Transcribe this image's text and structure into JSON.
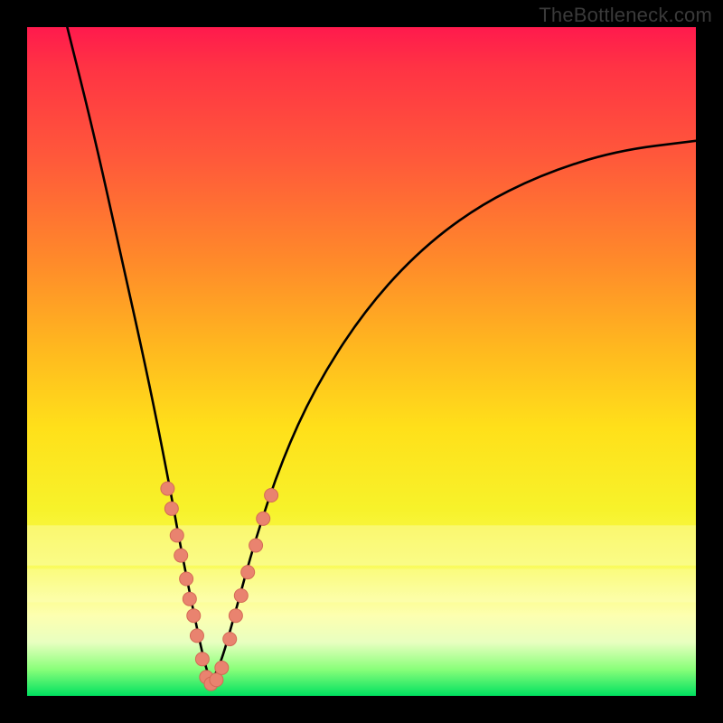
{
  "watermark": "TheBottleneck.com",
  "colors": {
    "curve": "#000000",
    "dot_fill": "#e9836f",
    "dot_stroke": "#d46a55",
    "hband_soft": "rgba(255,255,255,0.28)",
    "hband_softer": "rgba(255,255,255,0.18)"
  },
  "chart_data": {
    "type": "line",
    "title": "",
    "xlabel": "",
    "ylabel": "",
    "xlim": [
      0,
      100
    ],
    "ylim": [
      0,
      100
    ],
    "note": "Axes unlabeled; values estimated from pixel positions on a 0–100 normalized domain. y=0 means bottom (green), y=100 means top (red). Curve is a V-shaped bottleneck curve with minimum near x≈27.",
    "series": [
      {
        "name": "bottleneck-curve",
        "x": [
          6,
          10,
          14,
          18,
          21,
          23,
          25,
          26.5,
          27.5,
          29,
          31,
          34,
          38,
          43,
          50,
          58,
          67,
          77,
          88,
          100
        ],
        "y": [
          100,
          84,
          66,
          48,
          33,
          22,
          12,
          5,
          2,
          5,
          12,
          23,
          35,
          46,
          57,
          66,
          73,
          78,
          81.5,
          83
        ]
      }
    ],
    "marker_groups": [
      {
        "name": "left-branch-markers",
        "points": [
          {
            "x": 21.0,
            "y": 31.0
          },
          {
            "x": 21.6,
            "y": 28.0
          },
          {
            "x": 22.4,
            "y": 24.0
          },
          {
            "x": 23.0,
            "y": 21.0
          },
          {
            "x": 23.8,
            "y": 17.5
          },
          {
            "x": 24.3,
            "y": 14.5
          },
          {
            "x": 24.9,
            "y": 12.0
          },
          {
            "x": 25.4,
            "y": 9.0
          },
          {
            "x": 26.2,
            "y": 5.5
          }
        ]
      },
      {
        "name": "valley-markers",
        "points": [
          {
            "x": 26.8,
            "y": 2.8
          },
          {
            "x": 27.5,
            "y": 1.8
          },
          {
            "x": 28.3,
            "y": 2.4
          },
          {
            "x": 29.1,
            "y": 4.2
          }
        ]
      },
      {
        "name": "right-branch-markers",
        "points": [
          {
            "x": 30.3,
            "y": 8.5
          },
          {
            "x": 31.2,
            "y": 12.0
          },
          {
            "x": 32.0,
            "y": 15.0
          },
          {
            "x": 33.0,
            "y": 18.5
          },
          {
            "x": 34.2,
            "y": 22.5
          },
          {
            "x": 35.3,
            "y": 26.5
          },
          {
            "x": 36.5,
            "y": 30.0
          }
        ]
      }
    ],
    "horizontal_bands": [
      {
        "y_center": 22.5,
        "height": 6.0,
        "opacity": 0.28
      },
      {
        "y_center": 16.5,
        "height": 5.0,
        "opacity": 0.18
      }
    ]
  }
}
